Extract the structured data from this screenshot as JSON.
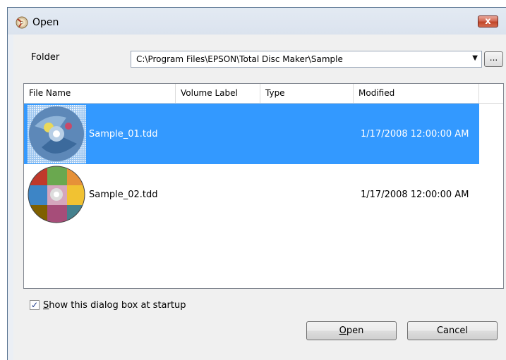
{
  "window": {
    "title": "Open",
    "close_glyph": "x"
  },
  "folder": {
    "label": "Folder",
    "path": "C:\\Program Files\\EPSON\\Total Disc Maker\\Sample",
    "browse_label": "..."
  },
  "filelist": {
    "columns": [
      "File Name",
      "Volume Label",
      "Type",
      "Modified"
    ],
    "rows": [
      {
        "name": "Sample_01.tdd",
        "volume_label": "",
        "type": "",
        "modified": "1/17/2008 12:00:00 AM",
        "selected": true,
        "thumbnail": "disc-thumbnail-blue-icon"
      },
      {
        "name": "Sample_02.tdd",
        "volume_label": "",
        "type": "",
        "modified": "1/17/2008 12:00:00 AM",
        "selected": false,
        "thumbnail": "disc-thumbnail-photo-icon"
      }
    ]
  },
  "startup": {
    "checked": true,
    "label": "Show this dialog box at startup",
    "mnemonic": "S"
  },
  "buttons": {
    "open": "Open",
    "cancel": "Cancel"
  },
  "colors": {
    "selection": "#3399ff",
    "close_button": "#c75c45"
  }
}
